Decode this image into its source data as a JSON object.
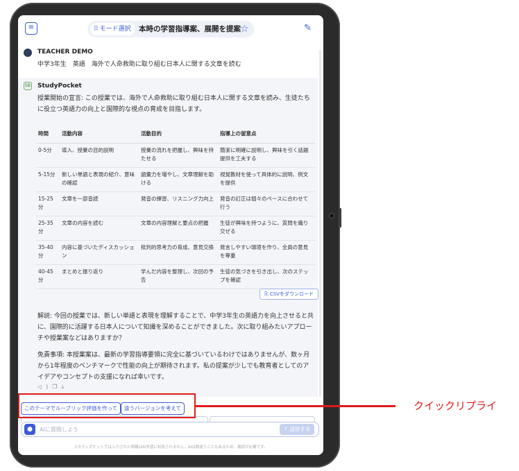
{
  "header": {
    "mode_select_label": "モード選択",
    "title": "本時の学習指導案、展開を提案"
  },
  "user_message": {
    "name": "TEACHER DEMO",
    "text": "中学3年生　英語　海外で人命救助に取り組む日本人に関する文章を読む"
  },
  "bot_message": {
    "name": "StudyPocket",
    "avatar_label": "SB",
    "intro": "授業開始の宣言: この授業では、海外で人命救助に取り組む日本人に関する文章を読み、生徒たちに役立つ英語力の向上と国際的な視点の育成を目指します。",
    "table": {
      "headers": [
        "時間",
        "活動内容",
        "活動目的",
        "指導上の留意点"
      ],
      "rows": [
        [
          "0-5分",
          "導入、授業の目的説明",
          "授業の流れを把握し、興味を持たせる",
          "簡潔に明確に説明し、興味を引く話題提供を工夫する"
        ],
        [
          "5-15分",
          "新しい単語と表現の紹介、意味の確認",
          "語彙力を増やし、文章理解を助ける",
          "視覚教材を使って具体的に説明、例文を提供"
        ],
        [
          "15-25分",
          "文章を一部音読",
          "発音の練習、リスニング力向上",
          "発音の訂正は個々のペースに合わせて行う"
        ],
        [
          "25-35分",
          "文章の内容を読む",
          "文章の内容理解と要点の把握",
          "生徒が興味を持つように、質問を織り交ぜる"
        ],
        [
          "35-40分",
          "内容に基づいたディスカッション",
          "批判的思考力の育成、意見交換",
          "発言しやすい環境を作り、全員の意見を尊重"
        ],
        [
          "40-45分",
          "まとめと振り返り",
          "学んだ内容を整理し、次回の予告",
          "生徒の気づきを引き出し、次のステップを確認"
        ]
      ]
    },
    "csv_button": "CSVをダウンロード",
    "explanation": "解説: 今回の授業では、新しい単語と表現を理解することで、中学3年生の英語力を向上させると共に、国際的に活躍する日本人について知識を深めることができました。次に取り組みたいアプローチや授業案などはありますか？",
    "disclaimer_text": "免責事項: 本授業案は、最新の学習指導要領に完全に基づいているわけではありませんが、数ヶ月から1年程度のベンチマークで性能の向上が期待されます。私の提案が少しでも教育者としてのアイデアやコンセプトの支援になれば幸いです。"
  },
  "quick_replies": [
    "このテーマでルーブリック評価を作って",
    "違うバージョンを考えて"
  ],
  "input": {
    "placeholder": "AIに質問しよう",
    "send_label": "送信する"
  },
  "footer_note": "スタディポケットでは入力された情報はAI学習に利用されません。AIは間違うこともあるため、確認が必要です。",
  "annotation": {
    "label": "クイックリプライ",
    "color": "#e21a1a"
  },
  "colors": {
    "accent": "#3b5bdb",
    "bot_bg": "#f4f5f9"
  },
  "icons": [
    "menu-icon",
    "grid-icon",
    "star-icon",
    "edit-icon",
    "user-avatar-icon",
    "bot-avatar-icon",
    "download-icon",
    "speaker-icon",
    "copy-icon",
    "mic-icon",
    "send-icon"
  ]
}
